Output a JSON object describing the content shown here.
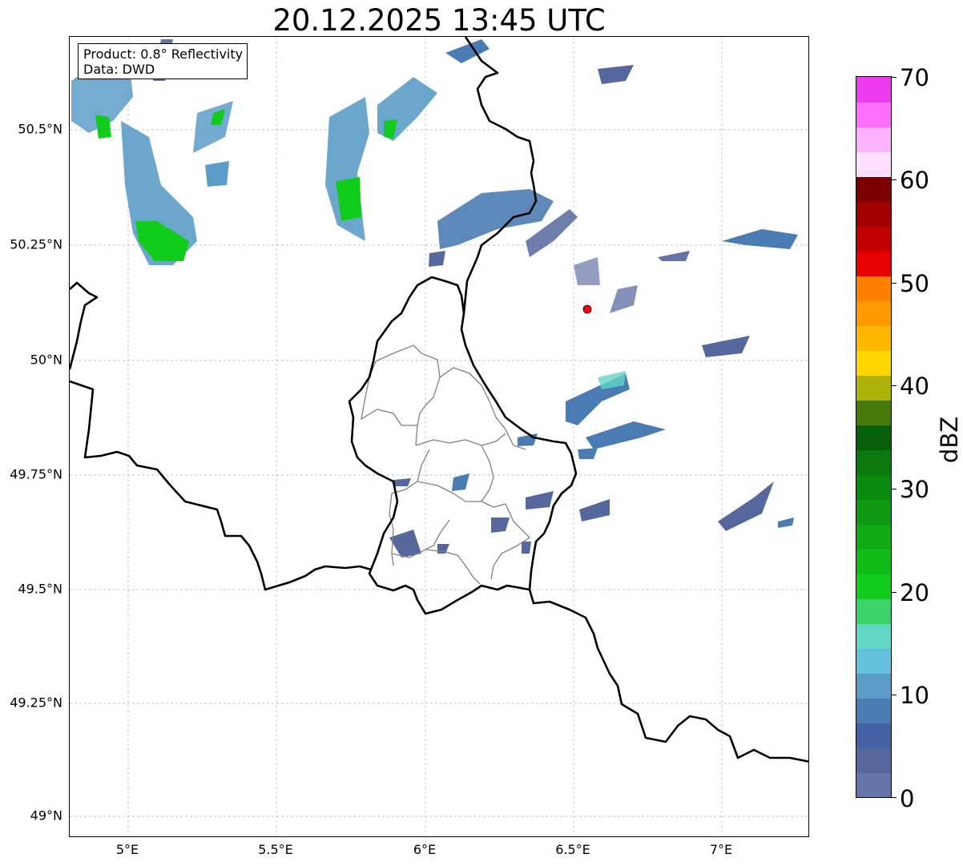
{
  "title": "20.12.2025 13:45 UTC",
  "info": {
    "product": "Product: 0.8° Reflectivity",
    "data": "Data: DWD"
  },
  "lat_labels": [
    "50.5°N",
    "50.25°N",
    "50°N",
    "49.75°N",
    "49.5°N",
    "49.25°N",
    "49°N"
  ],
  "lon_labels": [
    "5°E",
    "5.5°E",
    "6°E",
    "6.5°E",
    "7°E"
  ],
  "colorbar": {
    "unit": "dBZ",
    "tick_labels": [
      "0",
      "10",
      "20",
      "30",
      "40",
      "50",
      "60",
      "70"
    ],
    "colors": [
      "#6574a8",
      "#56679e",
      "#4461a6",
      "#4b7bb3",
      "#5b9dc8",
      "#65c0dc",
      "#62d6c4",
      "#3bd46b",
      "#11cc1a",
      "#10bd18",
      "#10ab14",
      "#0e9a12",
      "#0b8a10",
      "#0a780c",
      "#075f09",
      "#457a0a",
      "#adb30a",
      "#ffd700",
      "#ffb700",
      "#ff9a00",
      "#ff7f00",
      "#e60000",
      "#c30000",
      "#a10000",
      "#7d0000",
      "#ffdfff",
      "#ffb2ff",
      "#ff6fff",
      "#ef3bef"
    ]
  },
  "radar_marker": {
    "color": "#ff0000"
  },
  "colors": {
    "border": "#000000",
    "district": "#808080",
    "grid": "#b0b0b0"
  }
}
